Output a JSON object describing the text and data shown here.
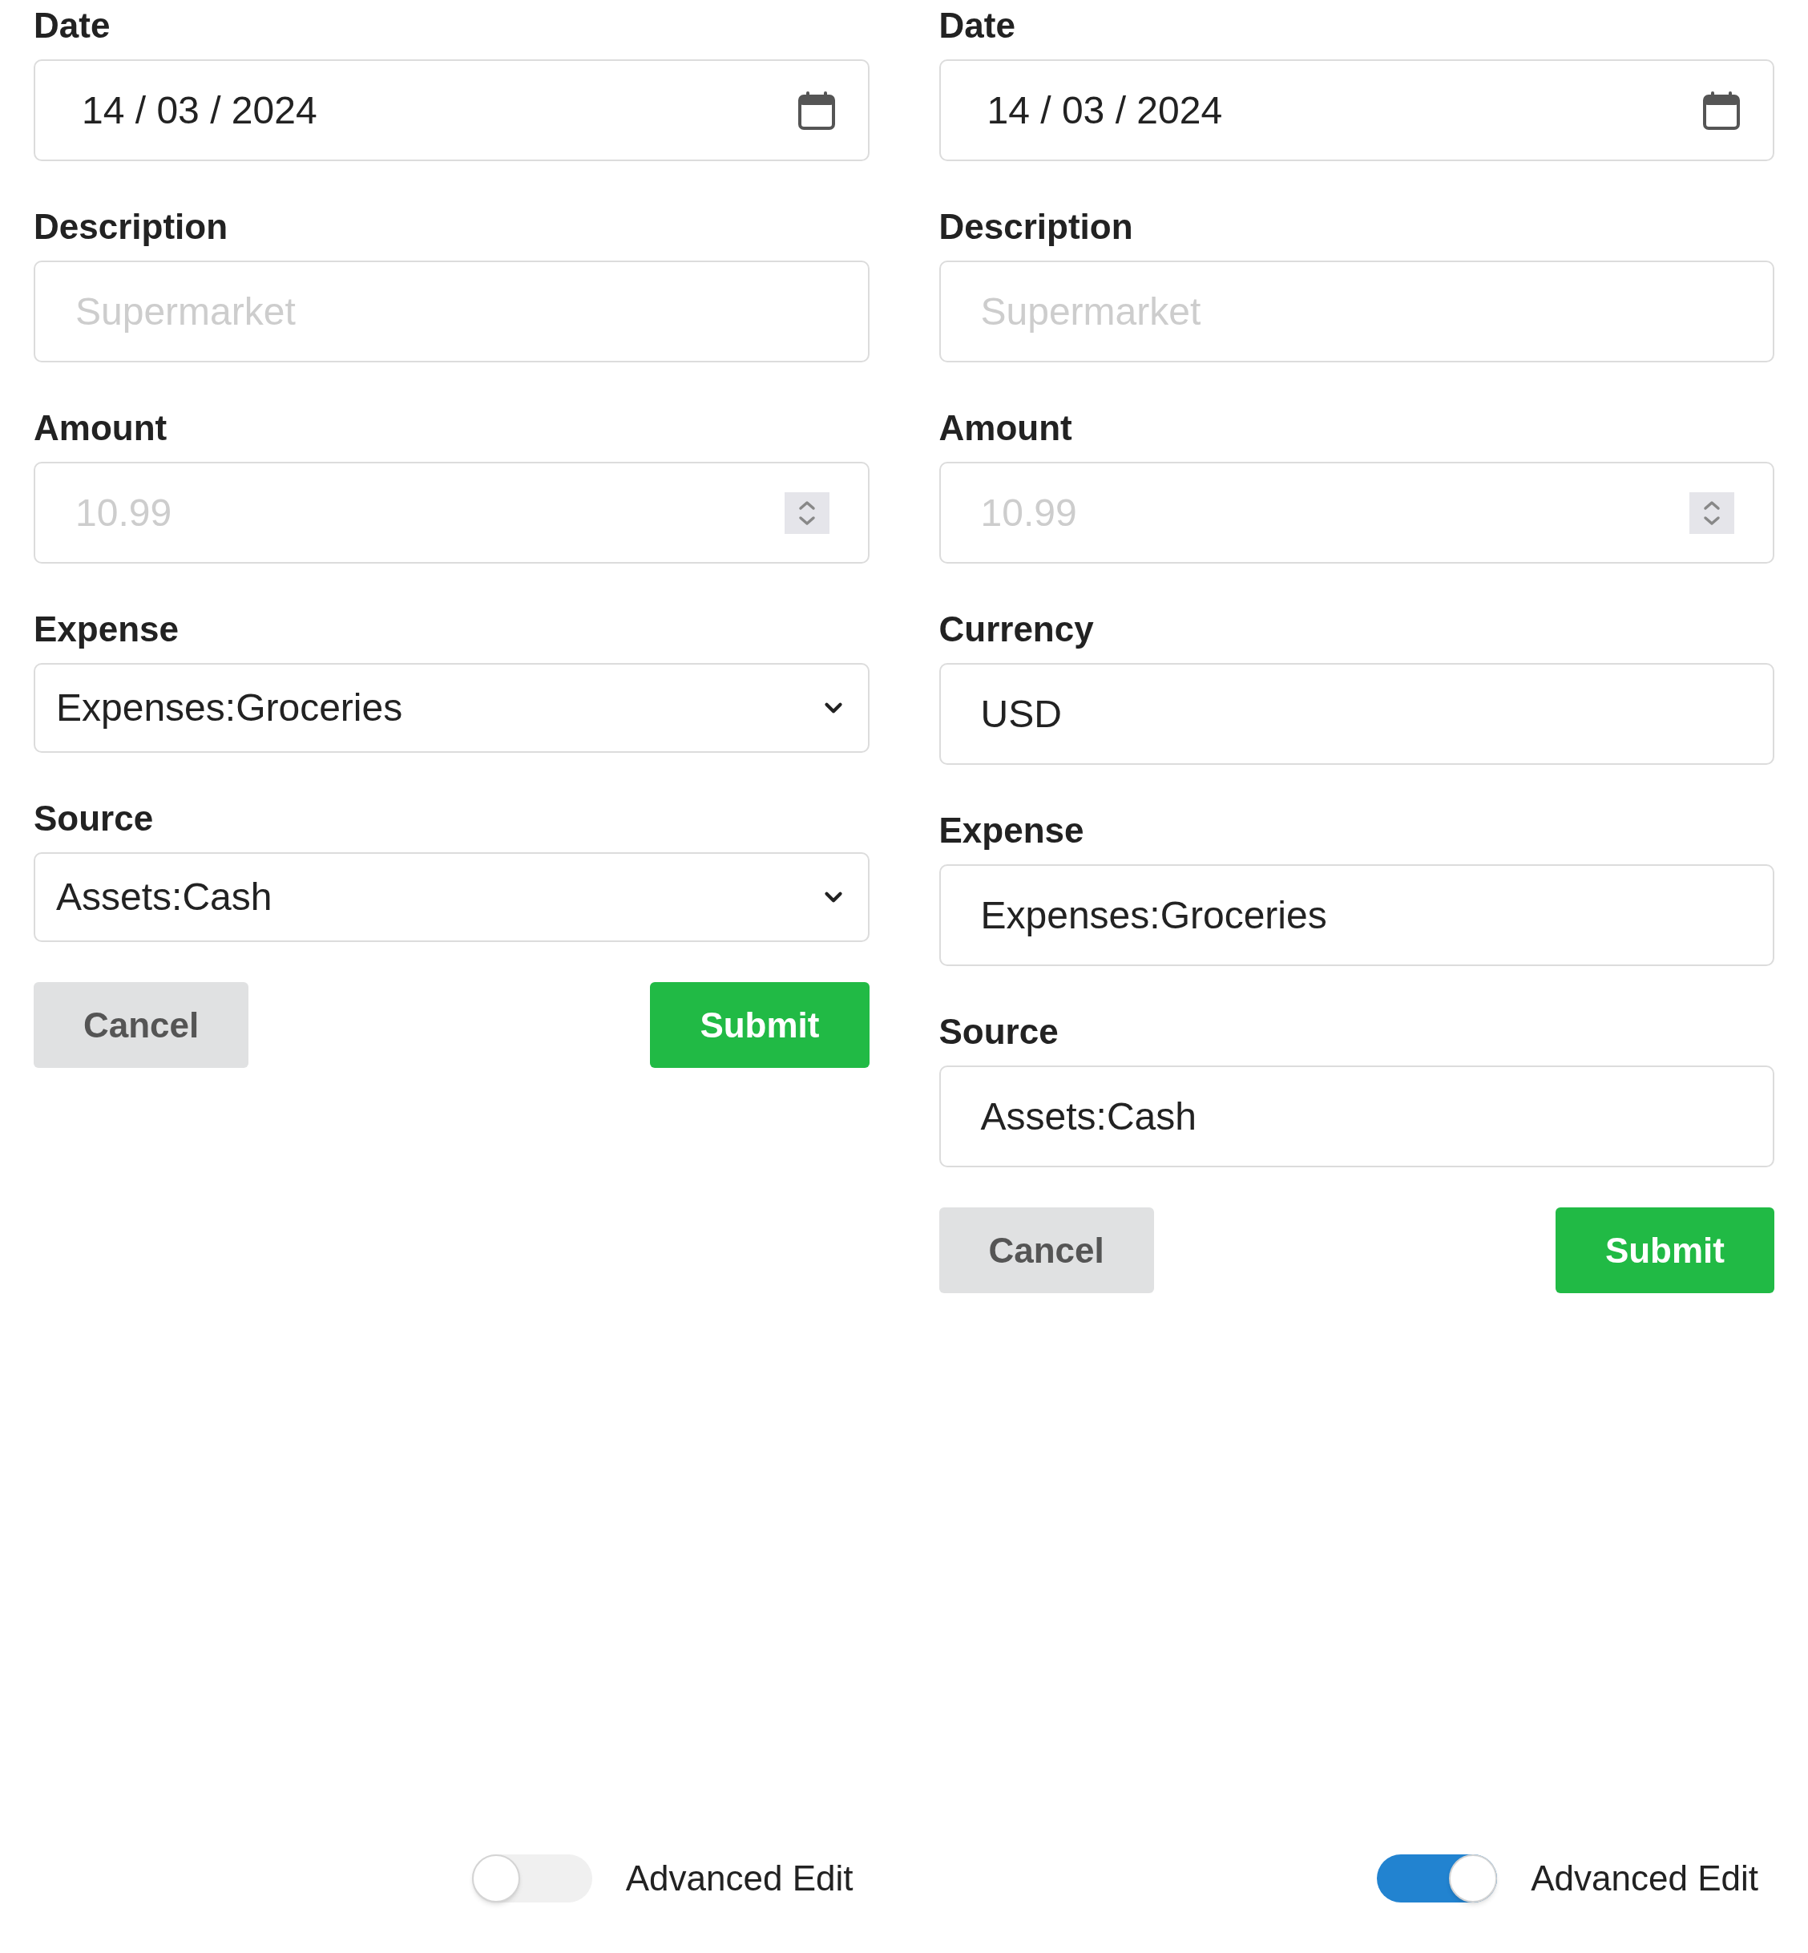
{
  "forms": [
    {
      "fields": [
        {
          "label": "Date",
          "kind": "date",
          "value": "14 / 03 / 2024"
        },
        {
          "label": "Description",
          "kind": "text",
          "placeholder": "Supermarket"
        },
        {
          "label": "Amount",
          "kind": "number",
          "placeholder": "10.99"
        },
        {
          "label": "Expense",
          "kind": "select",
          "value": "Expenses:Groceries"
        },
        {
          "label": "Source",
          "kind": "select",
          "value": "Assets:Cash"
        }
      ],
      "buttons": [
        {
          "label": "Cancel",
          "kind": "secondary"
        },
        {
          "label": "Submit",
          "kind": "primary"
        }
      ],
      "advanced_edit": {
        "label": "Advanced Edit",
        "on": false
      }
    },
    {
      "fields": [
        {
          "label": "Date",
          "kind": "date",
          "value": "14 / 03 / 2024"
        },
        {
          "label": "Description",
          "kind": "text",
          "placeholder": "Supermarket"
        },
        {
          "label": "Amount",
          "kind": "number",
          "placeholder": "10.99"
        },
        {
          "label": "Currency",
          "kind": "text",
          "value": "USD"
        },
        {
          "label": "Expense",
          "kind": "text",
          "value": "Expenses:Groceries"
        },
        {
          "label": "Source",
          "kind": "text",
          "value": "Assets:Cash"
        }
      ],
      "buttons": [
        {
          "label": "Cancel",
          "kind": "secondary"
        },
        {
          "label": "Submit",
          "kind": "primary"
        }
      ],
      "advanced_edit": {
        "label": "Advanced Edit",
        "on": true
      }
    }
  ]
}
